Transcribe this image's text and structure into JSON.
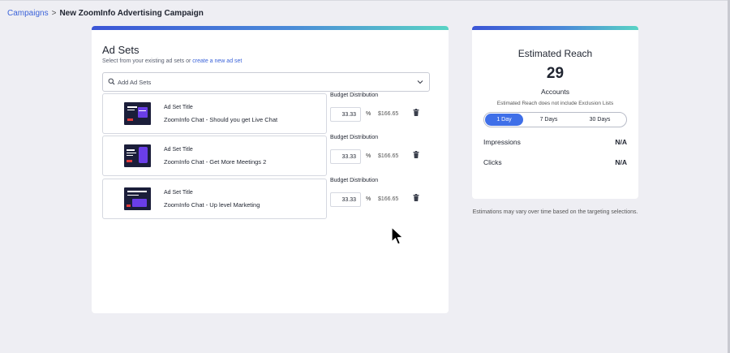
{
  "breadcrumb": {
    "parent": "Campaigns",
    "separator": ">",
    "current": "New ZoomInfo Advertising Campaign"
  },
  "adsets": {
    "title": "Ad Sets",
    "subtitle_prefix": "Select from your existing ad sets or",
    "subtitle_link": "create a new ad set",
    "search_placeholder": "Add Ad Sets",
    "items": [
      {
        "label": "Ad Set Title",
        "name": "ZoomInfo Chat - Should you get Live Chat",
        "budget_label": "Budget Distribution",
        "percent": "33.33",
        "percent_sign": "%",
        "amount": "$166.65"
      },
      {
        "label": "Ad Set Title",
        "name": "ZoomInfo Chat - Get More Meetings 2",
        "budget_label": "Budget Distribution",
        "percent": "33.33",
        "percent_sign": "%",
        "amount": "$166.65"
      },
      {
        "label": "Ad Set Title",
        "name": "ZoomInfo Chat - Up level Marketing",
        "budget_label": "Budget Distribution",
        "percent": "33.33",
        "percent_sign": "%",
        "amount": "$166.65"
      }
    ]
  },
  "reach": {
    "title": "Estimated Reach",
    "count": "29",
    "unit": "Accounts",
    "note": "Estimated Reach does not include Exclusion Lists",
    "periods": [
      "1 Day",
      "7 Days",
      "30 Days"
    ],
    "selected_period": "1 Day",
    "impressions_label": "Impressions",
    "impressions_value": "N/A",
    "clicks_label": "Clicks",
    "clicks_value": "N/A"
  },
  "estimation_note": "Estimations may vary over time based on the targeting selections.",
  "colors": {
    "accent": "#3f6fe8",
    "link": "#3b63d9",
    "gradient_start": "#3b55d6",
    "gradient_end": "#59d3c4"
  }
}
